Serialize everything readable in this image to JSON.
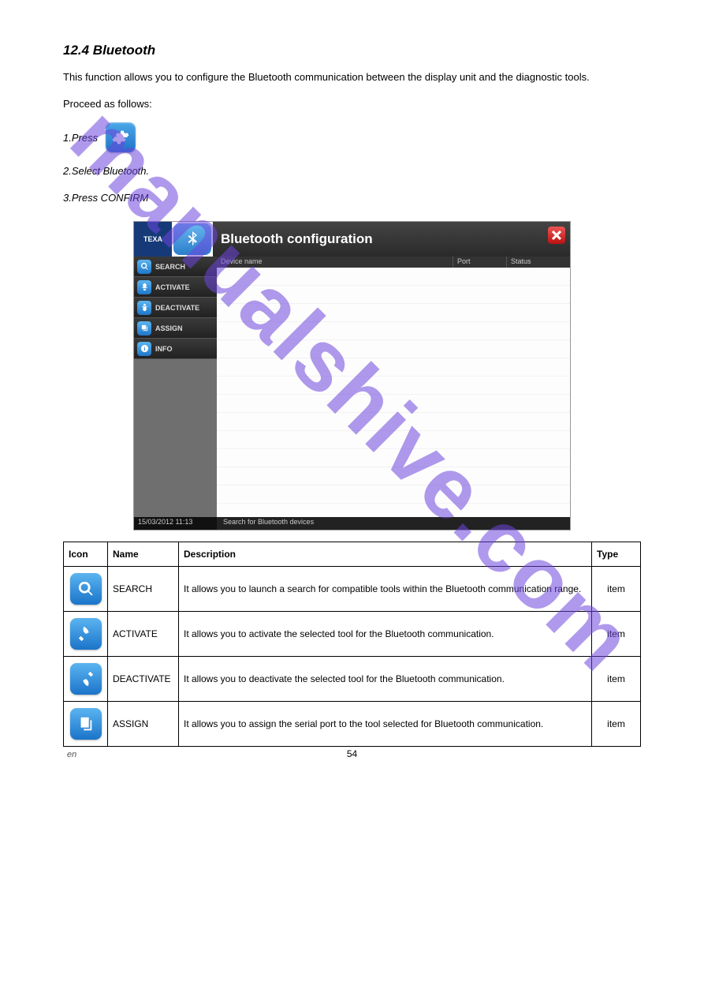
{
  "watermark": "manualshive.com",
  "section_title": "12.4 Bluetooth",
  "para1": "This function allows you to configure the Bluetooth communication between the display unit and the diagnostic tools.",
  "para2": "Proceed as follows:",
  "step1_label": "1.Press",
  "step2": "2.Select Bluetooth.",
  "step3": "3.Press CONFIRM",
  "app": {
    "logo": "TEXA",
    "title": "Bluetooth configuration",
    "columns": {
      "name": "Device name",
      "port": "Port",
      "status": "Status"
    },
    "sidebar": [
      {
        "label": "SEARCH"
      },
      {
        "label": "ACTIVATE"
      },
      {
        "label": "DEACTIVATE"
      },
      {
        "label": "ASSIGN"
      },
      {
        "label": "INFO"
      }
    ],
    "timestamp": "15/03/2012  11:13",
    "statusbar": "Search for Bluetooth devices"
  },
  "table": {
    "headers": {
      "icon": "Icon",
      "name": "Name",
      "desc": "Description",
      "type": "Type"
    },
    "rows": [
      {
        "name": "SEARCH",
        "desc": "It allows you to launch a search for compatible tools within the Bluetooth communication range.",
        "type": "item"
      },
      {
        "name": "ACTIVATE",
        "desc": "It allows you to activate the selected tool for the Bluetooth communication.",
        "type": "item"
      },
      {
        "name": "DEACTIVATE",
        "desc": "It allows you to deactivate the selected tool for the Bluetooth communication.",
        "type": "item"
      },
      {
        "name": "ASSIGN",
        "desc": "It allows you to assign the serial port to the tool selected for Bluetooth communication.",
        "type": "item"
      }
    ]
  },
  "footer": "en",
  "pagenum": "54"
}
